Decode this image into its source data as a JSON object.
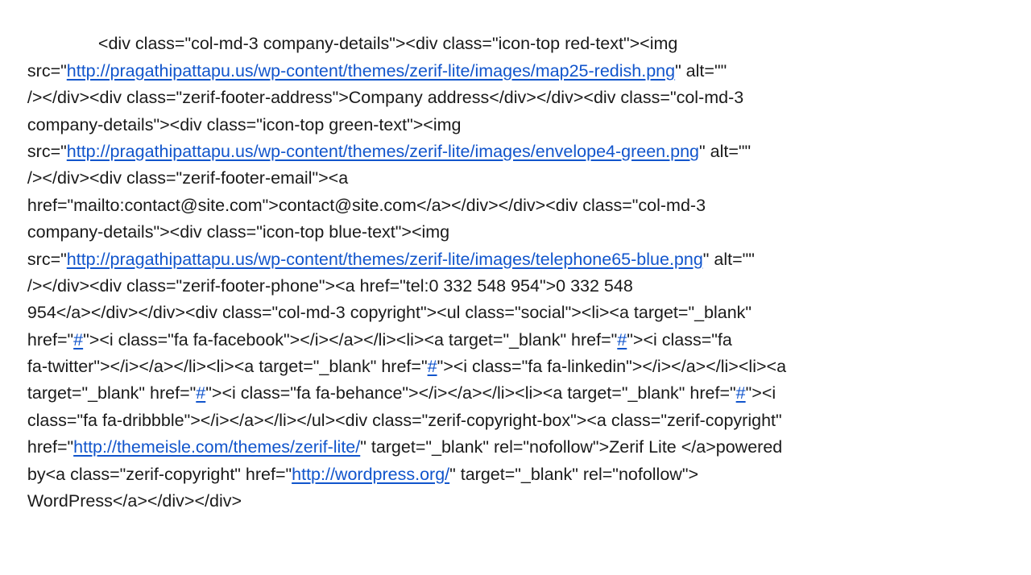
{
  "lines": [
    [
      {
        "t": "<div class=\"col-md-3 company-details\"><div class=\"icon-top red-text\"><img"
      }
    ],
    [
      {
        "t": "src=\""
      },
      {
        "t": "http://pragathipattapu.us/wp-content/themes/zerif-lite/images/map25-redish.png",
        "link": true,
        "name": "map-image-url-link"
      },
      {
        "t": "\" alt=\"\""
      }
    ],
    [
      {
        "t": "/></div><div class=\"zerif-footer-address\">Company address</div></div><div class=\"col-md-3"
      }
    ],
    [
      {
        "t": "company-details\"><div class=\"icon-top green-text\"><img"
      }
    ],
    [
      {
        "t": "src=\""
      },
      {
        "t": "http://pragathipattapu.us/wp-content/themes/zerif-lite/images/envelope4-green.png",
        "link": true,
        "name": "envelope-image-url-link"
      },
      {
        "t": "\" alt=\"\""
      }
    ],
    [
      {
        "t": "/></div><div class=\"zerif-footer-email\"><a"
      }
    ],
    [
      {
        "t": "href=\"mailto:contact@site.com\">contact@site.com</a></div></div><div class=\"col-md-3"
      }
    ],
    [
      {
        "t": "company-details\"><div class=\"icon-top blue-text\"><img"
      }
    ],
    [
      {
        "t": "src=\""
      },
      {
        "t": "http://pragathipattapu.us/wp-content/themes/zerif-lite/images/telephone65-blue.png",
        "link": true,
        "name": "telephone-image-url-link"
      },
      {
        "t": "\" alt=\"\""
      }
    ],
    [
      {
        "t": "/></div><div class=\"zerif-footer-phone\"><a href=\"tel:0 332 548 954\">0 332 548"
      }
    ],
    [
      {
        "t": "954</a></div></div><div class=\"col-md-3 copyright\"><ul class=\"social\"><li><a target=\"_blank\""
      }
    ],
    [
      {
        "t": "href=\""
      },
      {
        "t": "#",
        "link": true,
        "name": "facebook-hash-link"
      },
      {
        "t": "\"><i class=\"fa fa-facebook\"></i></a></li><li><a target=\"_blank\" href=\""
      },
      {
        "t": "#",
        "link": true,
        "name": "twitter-hash-link"
      },
      {
        "t": "\"><i class=\"fa"
      }
    ],
    [
      {
        "t": "fa-twitter\"></i></a></li><li><a target=\"_blank\" href=\""
      },
      {
        "t": "#",
        "link": true,
        "name": "linkedin-hash-link"
      },
      {
        "t": "\"><i class=\"fa fa-linkedin\"></i></a></li><li><a"
      }
    ],
    [
      {
        "t": "target=\"_blank\" href=\""
      },
      {
        "t": "#",
        "link": true,
        "name": "behance-hash-link"
      },
      {
        "t": "\"><i class=\"fa fa-behance\"></i></a></li><li><a target=\"_blank\" href=\""
      },
      {
        "t": "#",
        "link": true,
        "name": "dribbble-hash-link"
      },
      {
        "t": "\"><i"
      }
    ],
    [
      {
        "t": "class=\"fa fa-dribbble\"></i></a></li></ul><div class=\"zerif-copyright-box\"><a class=\"zerif-copyright\""
      }
    ],
    [
      {
        "t": "href=\""
      },
      {
        "t": "http://themeisle.com/themes/zerif-lite/",
        "link": true,
        "name": "themeisle-url-link"
      },
      {
        "t": "\" target=\"_blank\" rel=\"nofollow\">Zerif Lite </a>powered"
      }
    ],
    [
      {
        "t": "by<a class=\"zerif-copyright\" href=\""
      },
      {
        "t": "http://wordpress.org/",
        "link": true,
        "name": "wordpress-url-link"
      },
      {
        "t": "\" target=\"_blank\" rel=\"nofollow\">"
      }
    ],
    [
      {
        "t": "WordPress</a></div></div>"
      }
    ]
  ],
  "link_color": "#1155cc",
  "text_color": "#1a1a1a"
}
